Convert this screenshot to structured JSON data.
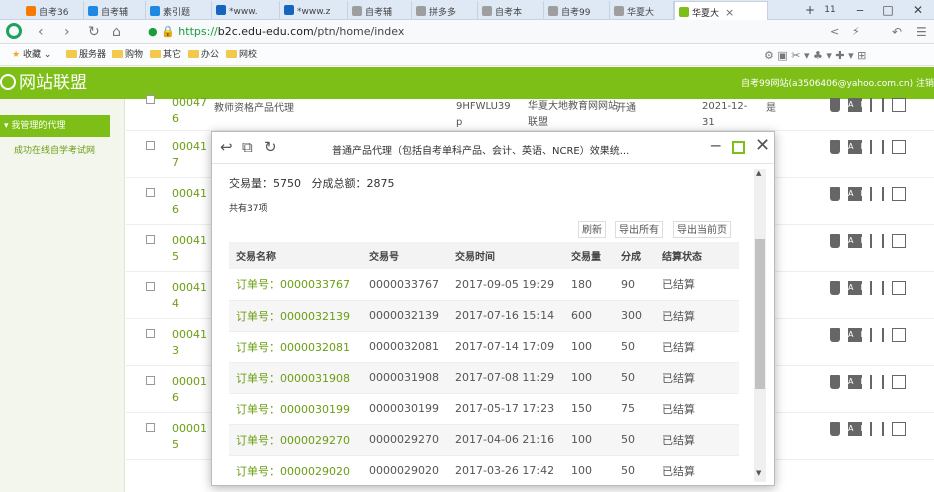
{
  "browser": {
    "tabs": [
      {
        "label": "自考36",
        "color": "#f57c00"
      },
      {
        "label": "自考辅",
        "color": "#1e88e5"
      },
      {
        "label": "素引题",
        "color": "#1e88e5"
      },
      {
        "label": "*www.",
        "color": "#1565c0"
      },
      {
        "label": "*www.z",
        "color": "#1565c0"
      },
      {
        "label": "自考辅",
        "color": "#9e9e9e"
      },
      {
        "label": "拼多多",
        "color": "#9e9e9e"
      },
      {
        "label": "自考本",
        "color": "#9e9e9e"
      },
      {
        "label": "自考99",
        "color": "#9e9e9e"
      },
      {
        "label": "华夏大",
        "color": "#9e9e9e"
      },
      {
        "label": "华夏大",
        "color": "#7dbf16"
      }
    ],
    "new_tab": "+",
    "tab_count": "11",
    "url_secure": "https://",
    "url_host": "b2c.edu-edu.com",
    "url_path": "/ptn/home/index",
    "bookmarks": [
      "收藏",
      "服务器",
      "购物",
      "其它",
      "办公",
      "网校"
    ]
  },
  "site": {
    "title": "网站联盟",
    "user": "自考99网站(a3506406@yahoo.com.cn)",
    "logout": "注销"
  },
  "sidebar": {
    "section": "我管理的代理",
    "item": "成功在线自学考试网"
  },
  "partial_row": {
    "id": "000476",
    "name": "教师资格产品代理",
    "code": "9HFWLU39",
    "code2": "p",
    "org": "华夏大地教育网网站",
    "org2": "联盟",
    "status": "开通",
    "date": "2021-12-",
    "date2": "31",
    "flag": "是"
  },
  "bg_rows": [
    {
      "id": "000417"
    },
    {
      "id": "000416"
    },
    {
      "id": "000415"
    },
    {
      "id": "000414"
    },
    {
      "id": "000413"
    },
    {
      "id": "000016"
    },
    {
      "id": "000015"
    }
  ],
  "modal": {
    "title": "普通产品代理（包括自考单科产品、会计、英语、NCRE）效果统...",
    "summary_label1": "交易量：",
    "summary_value1": "5750",
    "summary_label2": "分成总额：",
    "summary_value2": "2875",
    "count": "共有37项",
    "buttons": [
      "刷新",
      "导出所有",
      "导出当前页"
    ],
    "columns": [
      "交易名称",
      "交易号",
      "交易时间",
      "交易量",
      "分成",
      "结算状态"
    ],
    "rows": [
      [
        "订单号：0000033767",
        "0000033767",
        "2017-09-05 19:29",
        "180",
        "90",
        "已结算"
      ],
      [
        "订单号：0000032139",
        "0000032139",
        "2017-07-16 15:14",
        "600",
        "300",
        "已结算"
      ],
      [
        "订单号：0000032081",
        "0000032081",
        "2017-07-14 17:09",
        "100",
        "50",
        "已结算"
      ],
      [
        "订单号：0000031908",
        "0000031908",
        "2017-07-08 11:29",
        "100",
        "50",
        "已结算"
      ],
      [
        "订单号：0000030199",
        "0000030199",
        "2017-05-17 17:23",
        "150",
        "75",
        "已结算"
      ],
      [
        "订单号：0000029270",
        "0000029270",
        "2017-04-06 21:16",
        "100",
        "50",
        "已结算"
      ],
      [
        "订单号：0000029020",
        "0000029020",
        "2017-03-26 17:42",
        "100",
        "50",
        "已结算"
      ]
    ]
  }
}
